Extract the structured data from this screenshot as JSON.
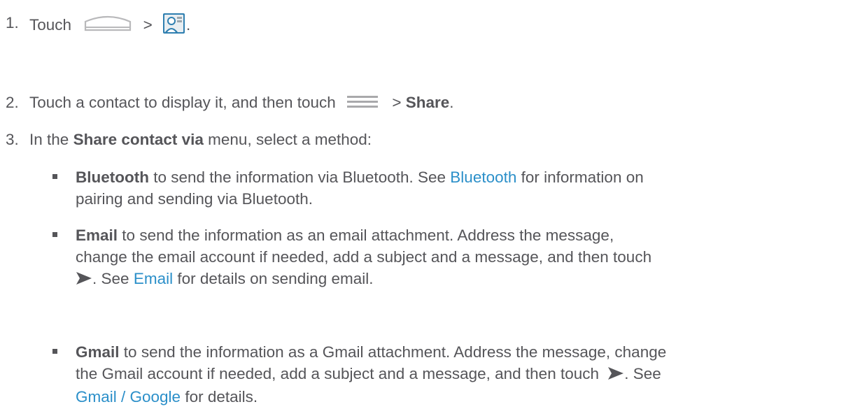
{
  "steps": [
    {
      "number": "1.",
      "text_before": "Touch",
      "separator": ">",
      "end": "."
    },
    {
      "number": "2.",
      "text_before": "Touch a contact to display it, and then touch",
      "separator": ">",
      "bold": "Share",
      "end": "."
    },
    {
      "number": "3.",
      "text_before": "In the",
      "bold": "Share contact via",
      "text_after": "menu, select a method:"
    }
  ],
  "methods": [
    {
      "name": "Bluetooth",
      "line1": "to send the information via Bluetooth. See",
      "link": "Bluetooth",
      "line1_end": "for information on",
      "line2": "pairing and sending via Bluetooth."
    },
    {
      "name": "Email",
      "line1": "to send the information as an email attachment. Address the message,",
      "line2": "change the email account if needed, add a subject and a message, and then touch",
      "line3_before": ". See",
      "link": "Email",
      "line3_after": "for details on sending email."
    },
    {
      "name": "Gmail",
      "line1": "to send the information as a Gmail attachment. Address the message, change",
      "line2_before": "the Gmail account if needed, add a subject and a message, and then touch",
      "line2_after": ". See",
      "link": "Gmail / Google",
      "line3_after": "for details."
    }
  ],
  "colors": {
    "text": "#555559",
    "link": "#2b8fc9"
  },
  "icons": {
    "home": "home-icon",
    "contacts": "contacts-app-icon",
    "menu": "menu-icon",
    "send": "send-icon"
  }
}
